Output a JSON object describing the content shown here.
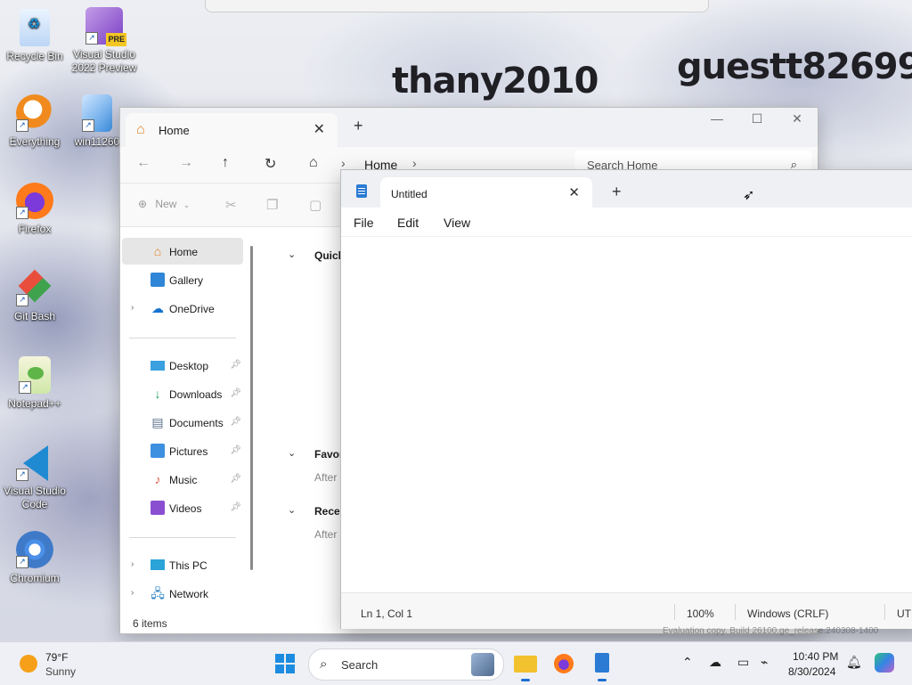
{
  "desktop": {
    "icons": [
      {
        "label": "Recycle Bin",
        "icon": "recycle-bin-icon"
      },
      {
        "label": "Visual Studio 2022 Preview",
        "badge": "PRE",
        "icon": "visual-studio-icon"
      },
      {
        "label": "Everything",
        "icon": "everything-search-icon"
      },
      {
        "label": "win11260",
        "icon": "file-icon"
      },
      {
        "label": "Firefox",
        "icon": "firefox-icon"
      },
      {
        "label": "Git Bash",
        "icon": "git-bash-icon"
      },
      {
        "label": "Notepad++",
        "icon": "notepadpp-icon"
      },
      {
        "label": "Visual Studio Code",
        "icon": "vscode-icon"
      },
      {
        "label": "Chromium",
        "icon": "chromium-icon"
      }
    ],
    "wallpaper_text": [
      "thany2010",
      "guestt82699"
    ]
  },
  "explorer": {
    "tab_title": "Home",
    "address": "Home",
    "search_placeholder": "Search Home",
    "toolbar_new": "New",
    "sidebar": [
      {
        "label": "Home",
        "icon": "home-icon",
        "selected": true
      },
      {
        "label": "Gallery",
        "icon": "gallery-icon"
      },
      {
        "label": "OneDrive",
        "icon": "onedrive-icon",
        "expandable": true
      },
      {
        "label": "Desktop",
        "icon": "desktop-folder-icon",
        "pinned": true
      },
      {
        "label": "Downloads",
        "icon": "downloads-icon",
        "pinned": true
      },
      {
        "label": "Documents",
        "icon": "documents-icon",
        "pinned": true
      },
      {
        "label": "Pictures",
        "icon": "pictures-icon",
        "pinned": true
      },
      {
        "label": "Music",
        "icon": "music-icon",
        "pinned": true
      },
      {
        "label": "Videos",
        "icon": "videos-icon",
        "pinned": true
      },
      {
        "label": "This PC",
        "icon": "this-pc-icon",
        "expandable": true
      },
      {
        "label": "Network",
        "icon": "network-icon",
        "expandable": true
      }
    ],
    "sections": [
      {
        "title": "Quick",
        "sub": ""
      },
      {
        "title": "Favor",
        "sub": "After"
      },
      {
        "title": "Recen",
        "sub": "After"
      }
    ],
    "status": "6 items"
  },
  "notepad": {
    "tab_title": "Untitled",
    "menu": [
      "File",
      "Edit",
      "View"
    ],
    "status": {
      "position": "Ln 1, Col 1",
      "zoom": "100%",
      "line_ending": "Windows (CRLF)",
      "encoding": "UTF"
    }
  },
  "watermark": "Evaluation copy. Build 26100.ge_release.240308-1400",
  "taskbar": {
    "weather_temp": "79°F",
    "weather_cond": "Sunny",
    "search_label": "Search",
    "time": "10:40 PM",
    "date": "8/30/2024"
  }
}
